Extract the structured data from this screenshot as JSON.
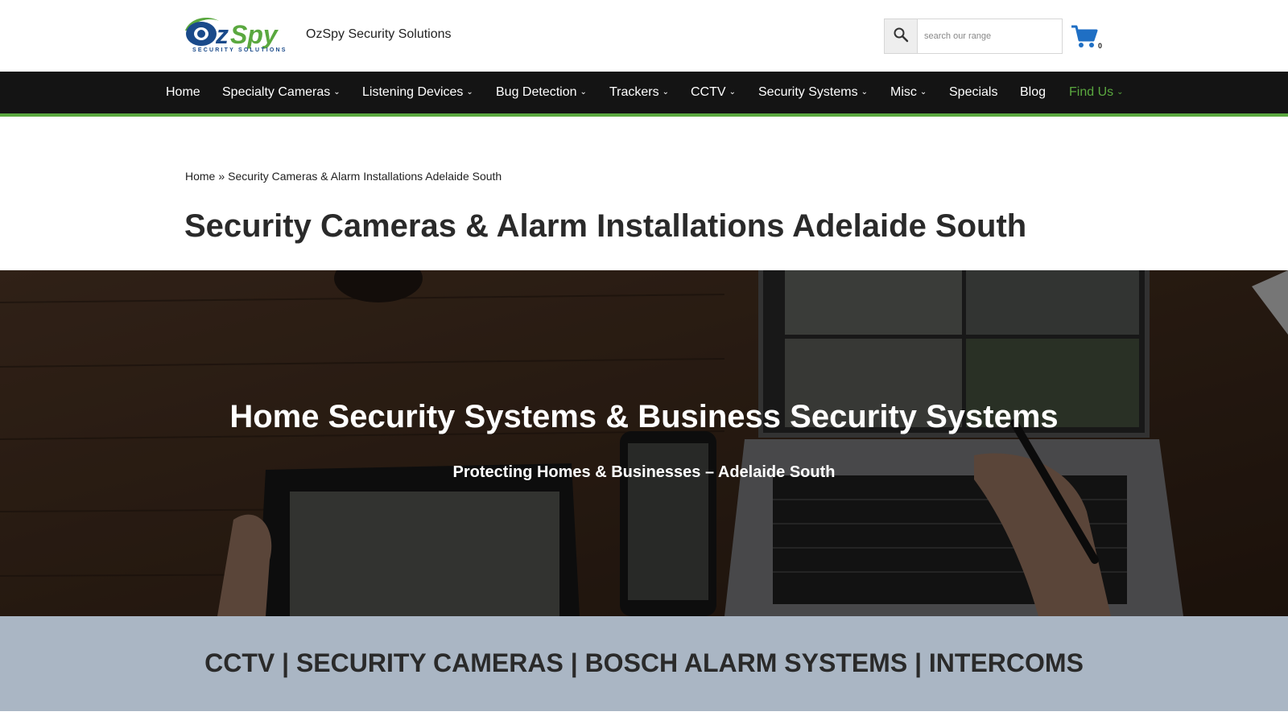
{
  "header": {
    "logo_text": "OzSpy",
    "logo_subtext": "SECURITY SOLUTIONS",
    "site_title": "OzSpy Security Solutions",
    "search_placeholder": "search our range",
    "search_icon": "search-icon",
    "cart_icon": "shopping-cart-icon",
    "cart_count": "0"
  },
  "nav": {
    "items": [
      {
        "label": "Home",
        "dropdown": false
      },
      {
        "label": "Specialty Cameras",
        "dropdown": true
      },
      {
        "label": "Listening Devices",
        "dropdown": true
      },
      {
        "label": "Bug Detection",
        "dropdown": true
      },
      {
        "label": "Trackers",
        "dropdown": true
      },
      {
        "label": "CCTV",
        "dropdown": true
      },
      {
        "label": "Security Systems",
        "dropdown": true
      },
      {
        "label": "Misc",
        "dropdown": true
      },
      {
        "label": "Specials",
        "dropdown": false
      },
      {
        "label": "Blog",
        "dropdown": false
      },
      {
        "label": "Find Us",
        "dropdown": true
      }
    ],
    "chevron": "⌄"
  },
  "breadcrumb": {
    "home": "Home",
    "separator": "»",
    "current": "Security Cameras & Alarm Installations Adelaide South"
  },
  "page_title": "Security Cameras & Alarm Installations Adelaide South",
  "hero": {
    "title": "Home Security Systems & Business Security Systems",
    "subtitle": "Protecting Homes & Businesses – Adelaide South"
  },
  "band": {
    "text": "CCTV | SECURITY CAMERAS | BOSCH ALARM SYSTEMS | INTERCOMS"
  },
  "colors": {
    "nav_bg": "#141414",
    "accent_green": "#5aa83f",
    "logo_blue": "#1a4a8a",
    "cart_blue": "#1f6fc4",
    "band_bg": "#aab6c4"
  }
}
